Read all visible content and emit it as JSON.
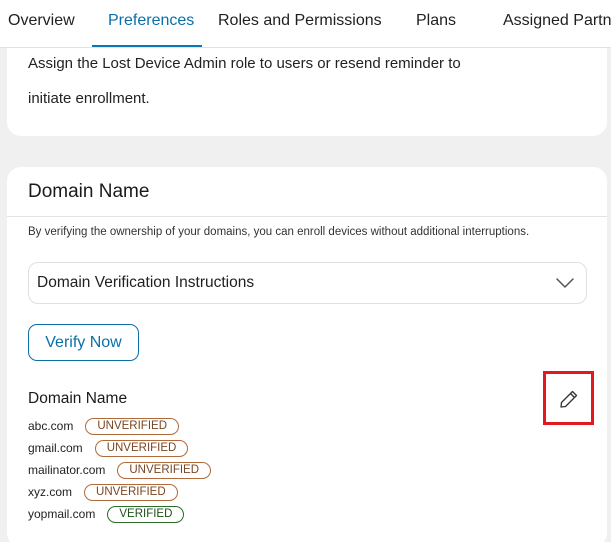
{
  "tabs": [
    {
      "label": "Overview"
    },
    {
      "label": "Preferences"
    },
    {
      "label": "Roles and Permissions"
    },
    {
      "label": "Plans"
    },
    {
      "label": "Assigned Partne"
    }
  ],
  "lost_device": {
    "line1": "Assign the Lost Device Admin role to users or resend reminder to",
    "line2": "initiate enrollment."
  },
  "domain_card": {
    "title": "Domain Name",
    "description": "By verifying the ownership of your domains, you can enroll devices without additional interruptions.",
    "accordion_label": "Domain Verification Instructions",
    "verify_label": "Verify Now",
    "list_header": "Domain Name",
    "domains": [
      {
        "name": "abc.com",
        "status": "UNVERIFIED"
      },
      {
        "name": "gmail.com",
        "status": "UNVERIFIED"
      },
      {
        "name": "mailinator.com",
        "status": "UNVERIFIED"
      },
      {
        "name": "xyz.com",
        "status": "UNVERIFIED"
      },
      {
        "name": "yopmail.com",
        "status": "VERIFIED"
      }
    ]
  },
  "colors": {
    "accent": "#0a6fa8",
    "highlight": "#e3171e",
    "unverified": "#b06a3a",
    "verified": "#2e6b2a"
  },
  "icons": [
    "chevron-down-icon",
    "pencil-icon"
  ]
}
